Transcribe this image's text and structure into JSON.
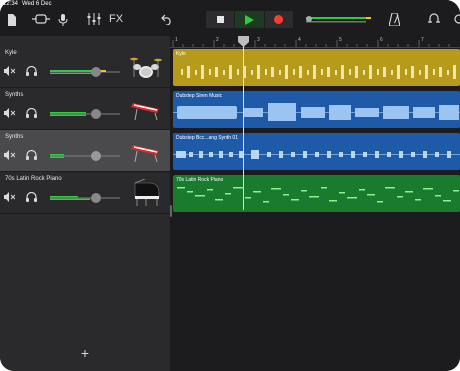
{
  "status": {
    "time": "12:34",
    "date": "Wed 6 Dec"
  },
  "toolbar": {
    "fx_label": "FX",
    "icons": [
      "document-icon",
      "track-view-icon",
      "microphone-icon",
      "mixer-icon",
      "undo-icon",
      "stop-icon",
      "play-icon",
      "record-icon",
      "metronome-icon",
      "loop-icon",
      "settings-icon"
    ],
    "colors": {
      "play": "#2ecc40",
      "record": "#ff3b30"
    }
  },
  "ruler": {
    "numbers": [
      "1",
      "2",
      "3",
      "4",
      "5",
      "6",
      "7"
    ]
  },
  "tracks": [
    {
      "name": "Kyle",
      "instrument": "drum-kit-icon",
      "volume": 0.65,
      "region_label": "Kyle",
      "region_color": "#b59a1c"
    },
    {
      "name": "Synths",
      "instrument": "keyboard-icon",
      "volume": 0.65,
      "region_label": "Dubstep Siren Music",
      "region_color": "#1e5aa8"
    },
    {
      "name": "Synths",
      "instrument": "keyboard-icon",
      "volume": 0.65,
      "region_label": "Dubstep Bcc...ang Synth 01",
      "region_color": "#1e5aa8"
    },
    {
      "name": "70s Latin Rock Piano",
      "instrument": "grand-piano-icon",
      "volume": 0.65,
      "region_label": "70s Latin Rock Piano",
      "region_color": "#1a7a2e"
    }
  ],
  "add_track": "+"
}
